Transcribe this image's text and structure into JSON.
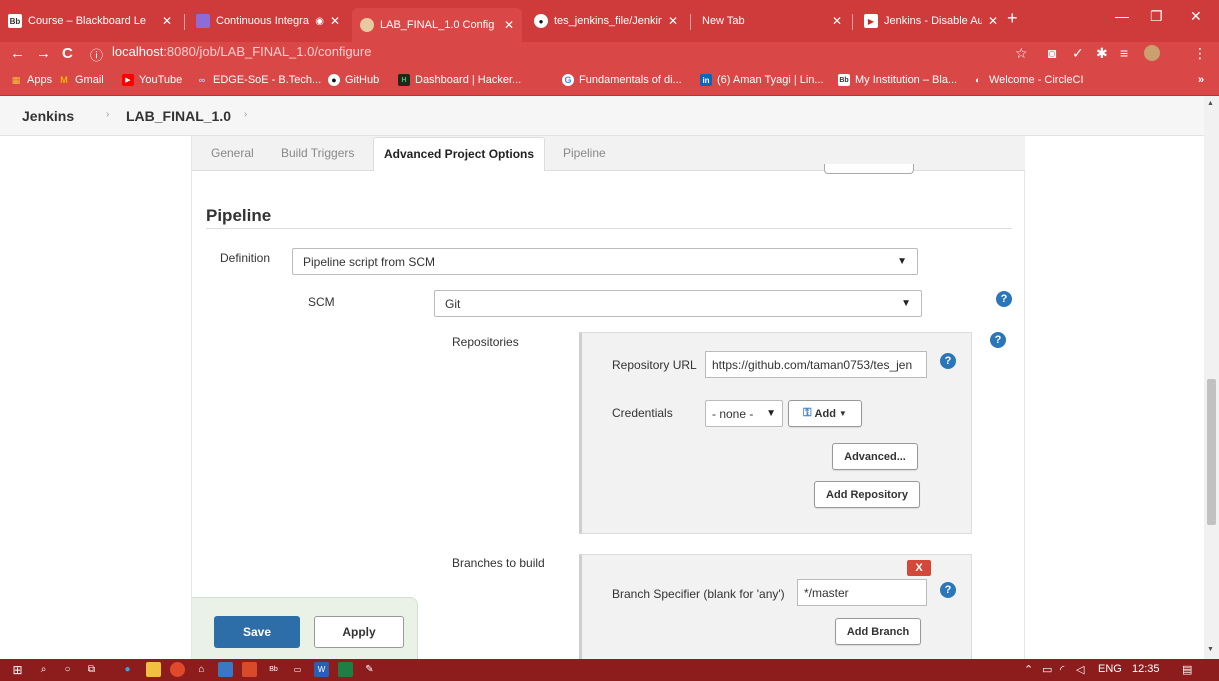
{
  "browser": {
    "tabs": [
      {
        "title": "Course – Blackboard Le",
        "favicon": "Bb",
        "favicon_color": "#333333",
        "active": false
      },
      {
        "title": "Continuous Integra",
        "favicon": "",
        "favicon_color": "#8e6bd8",
        "active": false,
        "recording": true
      },
      {
        "title": "LAB_FINAL_1.0 Config [",
        "favicon": "",
        "favicon_color": "#e8c9a0",
        "active": true
      },
      {
        "title": "tes_jenkins_file/Jenkins",
        "favicon": "",
        "favicon_color": "#111111",
        "active": false
      },
      {
        "title": "New Tab",
        "favicon": "",
        "favicon_color": "",
        "active": false
      },
      {
        "title": "Jenkins - Disable Authe",
        "favicon": "",
        "favicon_color": "#e02020",
        "active": false
      }
    ],
    "url_host": "localhost",
    "url_path": ":8080/job/LAB_FINAL_1.0/configure",
    "bookmarks": [
      {
        "label": "Apps",
        "icon": "apps-grid-icon"
      },
      {
        "label": "Gmail",
        "icon": "gmail-icon"
      },
      {
        "label": "YouTube",
        "icon": "youtube-icon"
      },
      {
        "label": "EDGE-SoE - B.Tech...",
        "icon": "edge-soe-icon"
      },
      {
        "label": "GitHub",
        "icon": "github-icon"
      },
      {
        "label": "Dashboard | Hacker...",
        "icon": "hackerrank-icon"
      },
      {
        "label": "Fundamentals of di...",
        "icon": "google-icon"
      },
      {
        "label": "(6) Aman Tyagi | Lin...",
        "icon": "linkedin-icon"
      },
      {
        "label": "My Institution – Bla...",
        "icon": "blackboard-icon"
      },
      {
        "label": "Welcome - CircleCI",
        "icon": "circleci-icon"
      }
    ],
    "bookmarks_more": "»"
  },
  "breadcrumb": {
    "root": "Jenkins",
    "job": "LAB_FINAL_1.0"
  },
  "config_tabs": [
    "General",
    "Build Triggers",
    "Advanced Project Options",
    "Pipeline"
  ],
  "active_config_tab": "Advanced Project Options",
  "pipeline": {
    "section_title": "Pipeline",
    "definition_label": "Definition",
    "definition_value": "Pipeline script from SCM",
    "scm_label": "SCM",
    "scm_value": "Git",
    "repositories_label": "Repositories",
    "repo_url_label": "Repository URL",
    "repo_url_value": "https://github.com/taman0753/tes_jen",
    "credentials_label": "Credentials",
    "credentials_value": "- none -",
    "add_label": "Add",
    "advanced_label": "Advanced...",
    "add_repository_label": "Add Repository",
    "branches_label": "Branches to build",
    "branch_specifier_label": "Branch Specifier (blank for 'any')",
    "branch_specifier_value": "*/master",
    "delete_label": "X",
    "add_branch_label": "Add Branch"
  },
  "actions": {
    "save_label": "Save",
    "apply_label": "Apply"
  },
  "taskbar": {
    "tray_lang": "ENG",
    "clock": "12:35"
  },
  "colors": {
    "browser_accent": "#d94747",
    "primary_button": "#2e6ea8",
    "help_icon": "#2a76b8",
    "delete_button": "#d24939",
    "taskbar": "#8d1d1d"
  }
}
